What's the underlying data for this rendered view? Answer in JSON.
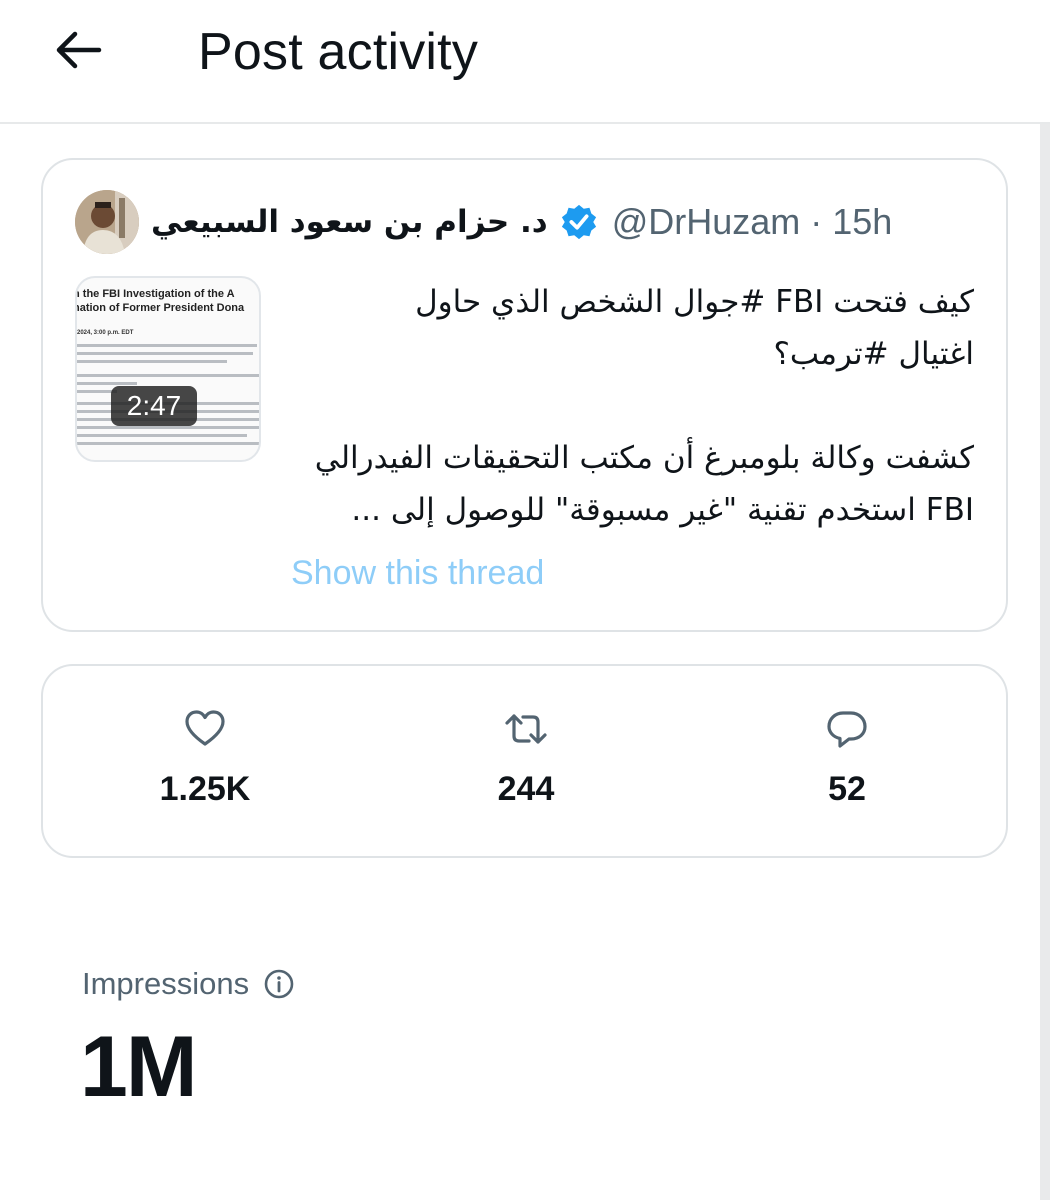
{
  "header": {
    "title": "Post activity",
    "back_icon": "arrow-left-icon"
  },
  "post": {
    "author_name": "د. حزام بن سعود السبيعي",
    "verified": true,
    "handle": "@DrHuzam",
    "separator": "·",
    "time": "15h",
    "media": {
      "duration": "2:47",
      "doc_line1": "n the FBI Investigation of the A",
      "doc_line2": "nation of Former President Dona",
      "doc_date": "2024, 3:00 p.m. EDT"
    },
    "text_lines": [
      "كيف فتحت FBI #جوال الشخص الذي حاول",
      "اغتيال #ترمب؟",
      "كشفت وكالة بلومبرغ أن مكتب التحقيقات الفيدرالي",
      "FBI  استخدم تقنية \"غير مسبوقة\" للوصول إلى ..."
    ],
    "show_thread": "Show this thread"
  },
  "stats": {
    "likes": {
      "icon": "heart-icon",
      "value": "1.25K"
    },
    "reposts": {
      "icon": "repost-icon",
      "value": "244"
    },
    "replies": {
      "icon": "reply-icon",
      "value": "52"
    }
  },
  "impressions": {
    "label": "Impressions",
    "icon": "info-icon",
    "value": "1M"
  },
  "colors": {
    "text": "#0f1419",
    "secondary": "#536471",
    "link": "#8ecdf8",
    "verified": "#1d9bf0",
    "border": "#dfe3e6"
  }
}
